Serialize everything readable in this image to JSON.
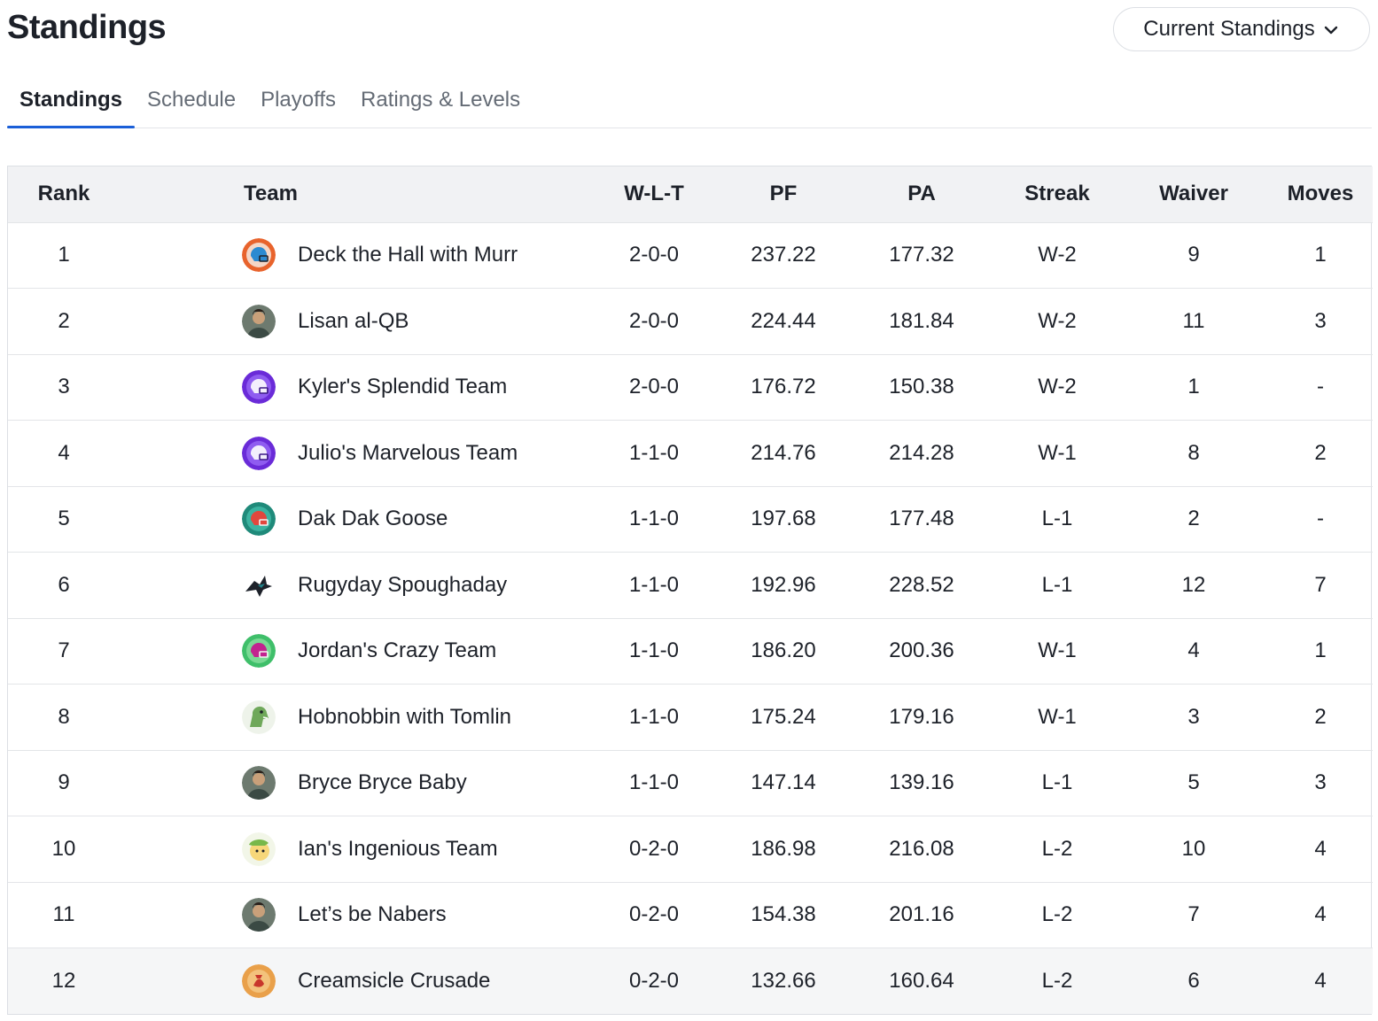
{
  "header": {
    "title": "Standings",
    "view_select": "Current Standings"
  },
  "tabs": [
    {
      "label": "Standings",
      "active": true
    },
    {
      "label": "Schedule",
      "active": false
    },
    {
      "label": "Playoffs",
      "active": false
    },
    {
      "label": "Ratings & Levels",
      "active": false
    }
  ],
  "columns": [
    "Rank",
    "Team",
    "W-L-T",
    "PF",
    "PA",
    "Streak",
    "Waiver",
    "Moves"
  ],
  "rows": [
    {
      "rank": "1",
      "team": "Deck the Hall with Murr",
      "wlt": "2-0-0",
      "pf": "237.22",
      "pa": "177.32",
      "streak": "W-2",
      "waiver": "9",
      "moves": "1",
      "avatar": "helmet-orange-icon"
    },
    {
      "rank": "2",
      "team": "Lisan al-QB",
      "wlt": "2-0-0",
      "pf": "224.44",
      "pa": "181.84",
      "streak": "W-2",
      "waiver": "11",
      "moves": "3",
      "avatar": "person-photo-icon"
    },
    {
      "rank": "3",
      "team": "Kyler's Splendid Team",
      "wlt": "2-0-0",
      "pf": "176.72",
      "pa": "150.38",
      "streak": "W-2",
      "waiver": "1",
      "moves": "-",
      "avatar": "helmet-purple-icon"
    },
    {
      "rank": "4",
      "team": "Julio's Marvelous Team",
      "wlt": "1-1-0",
      "pf": "214.76",
      "pa": "214.28",
      "streak": "W-1",
      "waiver": "8",
      "moves": "2",
      "avatar": "helmet-purple-icon"
    },
    {
      "rank": "5",
      "team": "Dak Dak Goose",
      "wlt": "1-1-0",
      "pf": "197.68",
      "pa": "177.48",
      "streak": "L-1",
      "waiver": "2",
      "moves": "-",
      "avatar": "helmet-teal-icon"
    },
    {
      "rank": "6",
      "team": "Rugyday Spoughaday",
      "wlt": "1-1-0",
      "pf": "192.96",
      "pa": "228.52",
      "streak": "L-1",
      "waiver": "12",
      "moves": "7",
      "avatar": "shark-logo-icon"
    },
    {
      "rank": "7",
      "team": "Jordan's Crazy Team",
      "wlt": "1-1-0",
      "pf": "186.20",
      "pa": "200.36",
      "streak": "W-1",
      "waiver": "4",
      "moves": "1",
      "avatar": "helmet-green-icon"
    },
    {
      "rank": "8",
      "team": "Hobnobbin with Tomlin",
      "wlt": "1-1-0",
      "pf": "175.24",
      "pa": "179.16",
      "streak": "W-1",
      "waiver": "3",
      "moves": "2",
      "avatar": "dinosaur-icon"
    },
    {
      "rank": "9",
      "team": "Bryce Bryce Baby",
      "wlt": "1-1-0",
      "pf": "147.14",
      "pa": "139.16",
      "streak": "L-1",
      "waiver": "5",
      "moves": "3",
      "avatar": "person-photo-icon"
    },
    {
      "rank": "10",
      "team": "Ian's Ingenious Team",
      "wlt": "0-2-0",
      "pf": "186.98",
      "pa": "216.08",
      "streak": "L-2",
      "waiver": "10",
      "moves": "4",
      "avatar": "cartoon-face-icon"
    },
    {
      "rank": "11",
      "team": "Let’s be Nabers",
      "wlt": "0-2-0",
      "pf": "154.38",
      "pa": "201.16",
      "streak": "L-2",
      "waiver": "7",
      "moves": "4",
      "avatar": "person-photo-icon"
    },
    {
      "rank": "12",
      "team": "Creamsicle Crusade",
      "wlt": "0-2-0",
      "pf": "132.66",
      "pa": "160.64",
      "streak": "L-2",
      "waiver": "6",
      "moves": "4",
      "avatar": "pirate-logo-icon"
    }
  ],
  "colors": {
    "accent": "#1b5fd8",
    "header_bg": "#f1f2f4",
    "border": "#dcdfe4"
  }
}
